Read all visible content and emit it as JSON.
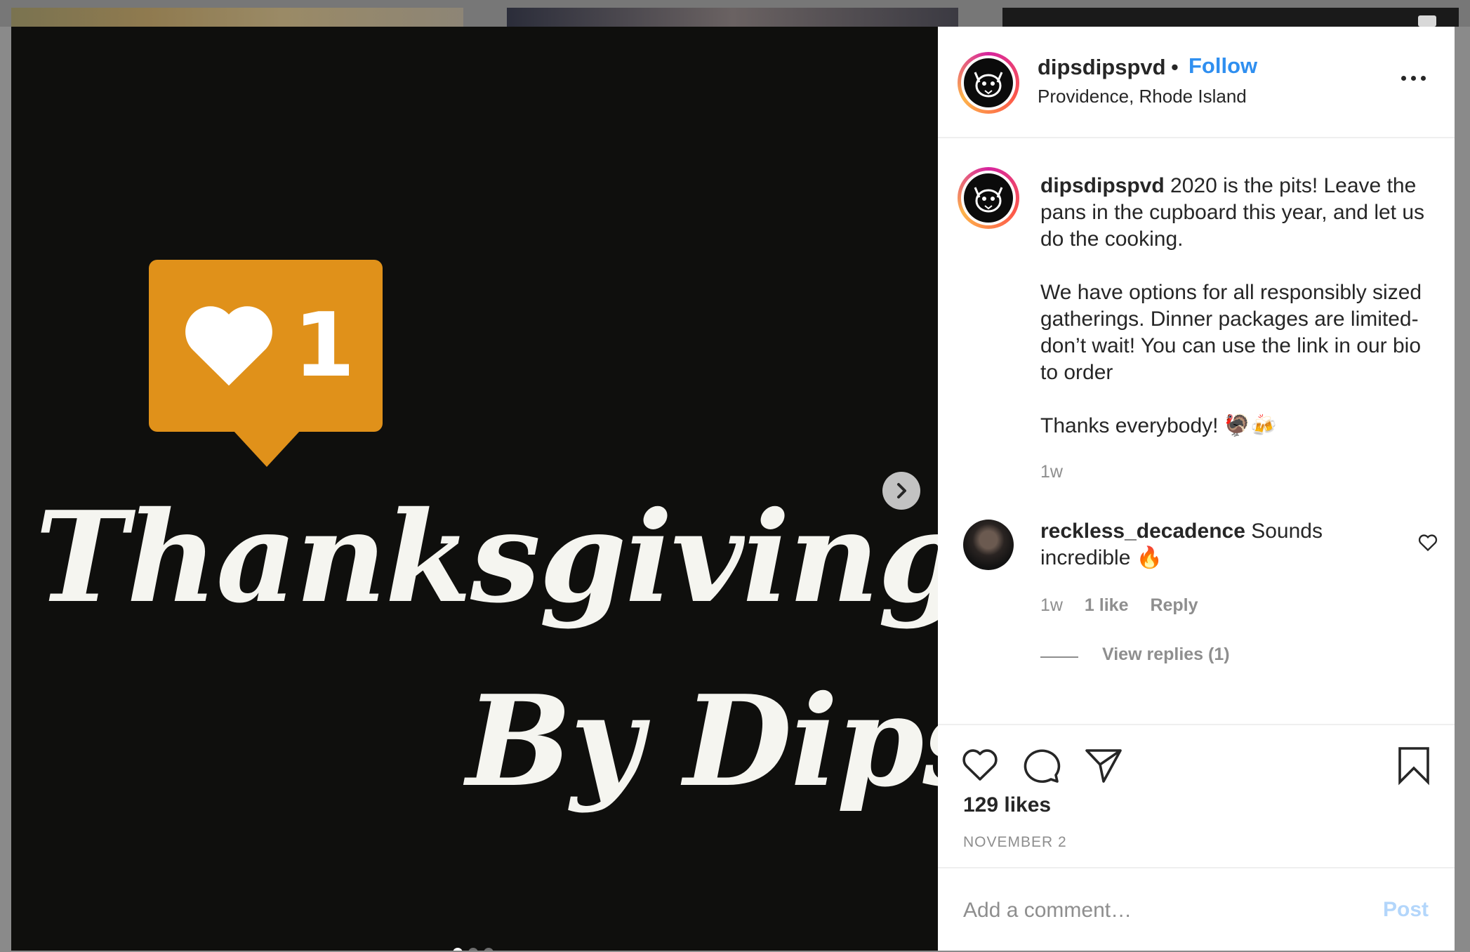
{
  "post": {
    "image": {
      "notification_count": "1",
      "title_line1": "Thanksgiving",
      "title_line2": "By Dips",
      "carousel_total": 3,
      "carousel_active": 1
    },
    "header": {
      "username": "dipsdipspvd",
      "separator": "•",
      "follow_label": "Follow",
      "location": "Providence, Rhode Island"
    },
    "caption": {
      "username": "dipsdipspvd",
      "text": " 2020 is the pits! Leave the pans in the cupboard this year, and let us do the cooking.\n\nWe have options for all responsibly sized gatherings. Dinner packages are limited-don’t wait! You can use the link in our bio to order\n\nThanks everybody! 🦃🍻",
      "time": "1w"
    },
    "comments": [
      {
        "username": "reckless_decadence",
        "text": " Sounds incredible 🔥",
        "time": "1w",
        "likes": "1 like",
        "reply_label": "Reply",
        "view_replies": "View replies (1)"
      }
    ],
    "likes": "129 likes",
    "date": "NOVEMBER 2",
    "add_comment": {
      "placeholder": "Add a comment…",
      "post_label": "Post"
    }
  },
  "colors": {
    "follow": "#2f8ff0",
    "notification": "#e0911a",
    "post_disabled": "#b3d6fb",
    "muted": "#8e8e8e"
  },
  "icons": {
    "next": "chevron-right-icon",
    "like": "heart-icon",
    "comment": "comment-icon",
    "share": "paper-plane-icon",
    "save": "bookmark-icon",
    "more": "more-horizontal-icon"
  }
}
